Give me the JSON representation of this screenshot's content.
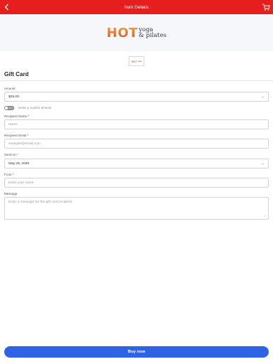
{
  "header": {
    "title": "Item Details",
    "back_icon": "chevron-left-icon",
    "cart_icon": "cart-icon",
    "color": "#e61e1e"
  },
  "logo": {
    "brand_word": "HOT",
    "line1": "yoga",
    "line2": "& pilates"
  },
  "form": {
    "title": "Gift Card",
    "amount": {
      "label": "Amount",
      "value": "$25.00"
    },
    "custom_amount_toggle": {
      "state": "OFF",
      "label": "Enter a custom amount"
    },
    "recipient_name": {
      "label": "Recipient Name *",
      "placeholder": "Name"
    },
    "recipient_email": {
      "label": "Recipient Email *",
      "placeholder": "example@email.com"
    },
    "send_on": {
      "label": "Send on *",
      "value": "May 26, 2025"
    },
    "from": {
      "label": "From *",
      "placeholder": "Enter your name"
    },
    "message": {
      "label": "Message",
      "placeholder": "Enter a message for the gift card recipient"
    }
  },
  "buy_button": {
    "label": "Buy now",
    "color": "#2e63e8"
  }
}
